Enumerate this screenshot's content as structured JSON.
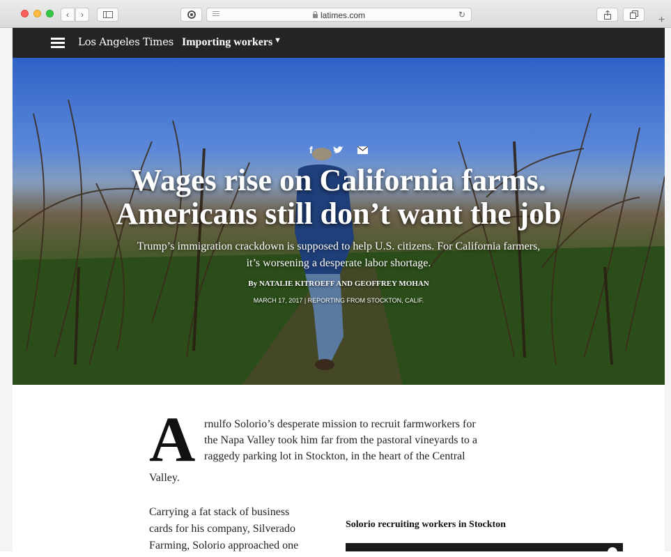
{
  "browser": {
    "url": "latimes.com"
  },
  "site": {
    "brand": "Los Angeles Times",
    "section": "Importing workers",
    "section_caret": "▼"
  },
  "hero": {
    "share_icons": [
      "facebook-icon",
      "twitter-icon",
      "email-icon"
    ],
    "headline_line1": "Wages rise on California farms.",
    "headline_line2": "Americans still don’t want the job",
    "dek_line1": "Trump’s immigration crackdown is supposed to help U.S. citizens. For California farmers,",
    "dek_line2": "it’s worsening a desperate labor shortage.",
    "byline": "By NATALIE KITROEFF AND GEOFFREY MOHAN",
    "dateline": "MARCH 17, 2017 | REPORTING FROM STOCKTON, CALIF."
  },
  "article": {
    "dropcap": "A",
    "para1_lines": [
      "rnulfo Solorio’s desperate mission to recruit farmworkers for",
      "the Napa Valley took him far from the pastoral vineyards to a",
      "raggedy parking lot in Stockton, in the heart of the Central"
    ],
    "para1_last": "Valley.",
    "para2_lines": [
      "Carrying a fat stack of business",
      "cards for his company, Silverado",
      "Farming, Solorio approached one"
    ],
    "video_caption": "Solorio recruiting workers in Stockton"
  }
}
